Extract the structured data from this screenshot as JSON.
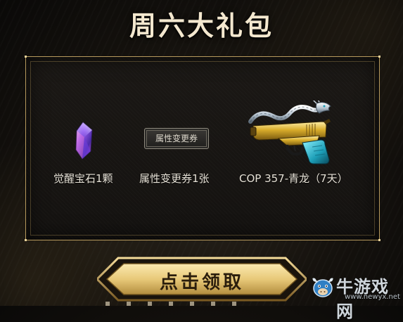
{
  "page": {
    "title": "周六大礼包"
  },
  "rewards": [
    {
      "name": "awakening-gem",
      "label": "觉醒宝石1颗",
      "icon": "purple-gem-icon"
    },
    {
      "name": "attribute-voucher",
      "label": "属性变更券1张",
      "icon": "voucher-card-icon",
      "card_text": "属性变更券"
    },
    {
      "name": "cop357-pistol",
      "label": "COP 357-青龙（7天）",
      "icon": "dragon-pistol-icon"
    }
  ],
  "claim_button": {
    "label": "点击领取"
  },
  "watermark": {
    "name": "牛游戏网",
    "url": "www.newyx.net"
  },
  "colors": {
    "gold": "#b79a5d",
    "title": "#f4e8cf",
    "button_fill": "#e8c979"
  }
}
